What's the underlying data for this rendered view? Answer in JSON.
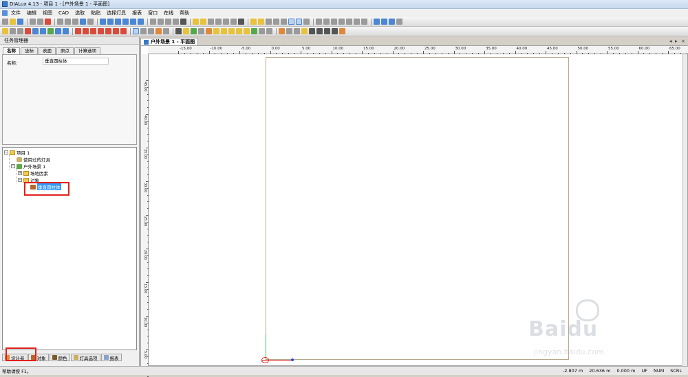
{
  "window": {
    "title": "DIALux 4.13 - 项目 1 - [户外场景 1 - 平面图]"
  },
  "menu": [
    "文件",
    "编辑",
    "视图",
    "CAD",
    "选取",
    "粘贴",
    "选择灯具",
    "报表",
    "窗口",
    "在线",
    "帮助"
  ],
  "left_panel": {
    "header": "任务管理器",
    "tabs": [
      "名称",
      "坐标",
      "表面",
      "原点",
      "计算选项"
    ],
    "active_tab": "名称",
    "name_label": "名称:",
    "name_value": "垂直圆柱体"
  },
  "tree": {
    "root": "项目 1",
    "used_luminaires": "使用过的灯具",
    "scene": "户外场景 1",
    "site_elements": "场地因素",
    "objects": "对象",
    "selected_object": "垂直圆柱体"
  },
  "bottom_tabs": [
    "设计者",
    "对象",
    "颜色",
    "灯具选项",
    "报表"
  ],
  "document_tab": "户外场景 1 - 平面图",
  "ruler": {
    "h_labels": [
      "-15.00",
      "-10.00",
      "-5.00",
      "0.00",
      "5.00",
      "10.00",
      "15.00",
      "20.00",
      "25.00",
      "30.00",
      "35.00",
      "40.00",
      "45.00",
      "50.00",
      "55.00",
      "60.00",
      "65.00"
    ],
    "v_labels": [
      "45.00",
      "40.00",
      "35.00",
      "30.00",
      "25.00",
      "20.00",
      "15.00",
      "10.00",
      "5.00"
    ]
  },
  "status": {
    "help": "帮助请按 F1。",
    "x": "-2.807 m",
    "y": "20.636 m",
    "z": "0.000 m",
    "flags": [
      "UF",
      "NUM",
      "SCRL"
    ]
  },
  "watermark": {
    "text": "Baidu",
    "sub": "jingyan.baidu.com"
  },
  "colors": {
    "highlight": "#e0201a",
    "selection": "#3399ff"
  }
}
